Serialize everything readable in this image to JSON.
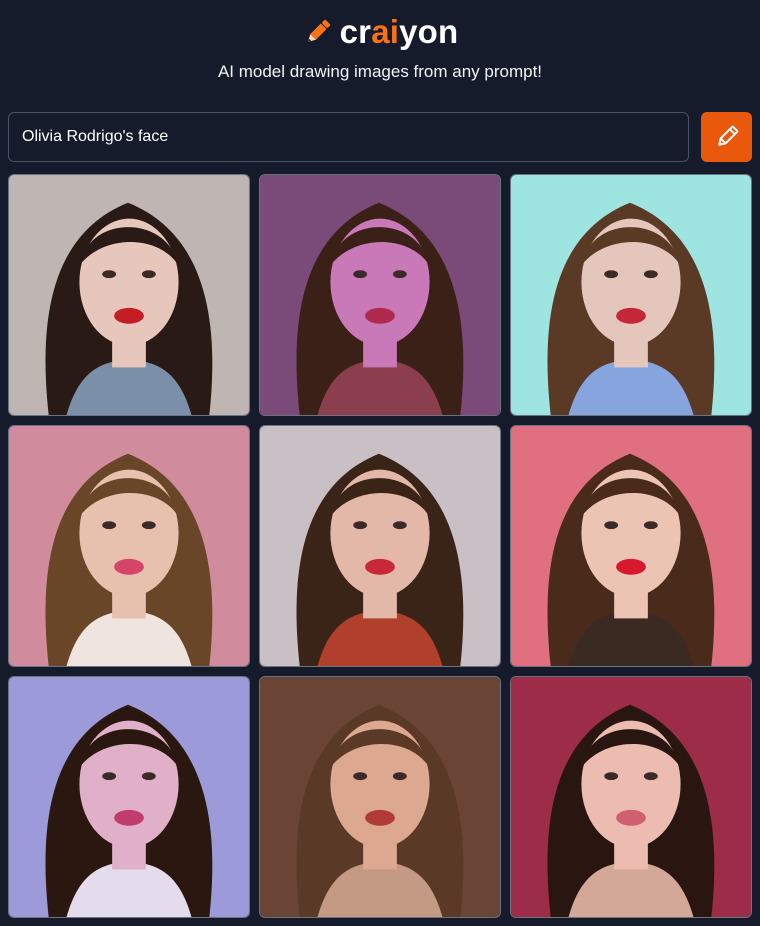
{
  "header": {
    "logo_part1": "cr",
    "logo_accent": "ai",
    "logo_part2": "yon",
    "tagline": "AI model drawing images from any prompt!"
  },
  "prompt": {
    "value": "Olivia Rodrigo's face"
  },
  "colors": {
    "background": "#151b2b",
    "accent": "#ea580c",
    "logo_accent": "#f97316"
  },
  "icons": {
    "logo": "pencil-icon",
    "draw_button": "pencil-icon"
  },
  "images": [
    {
      "bg": "#bfb6b4",
      "hair": "#2a1a16",
      "skin": "#e7c7bb",
      "lips": "#c41e24",
      "cloth": "#7c8fa8"
    },
    {
      "bg": "#7a4a78",
      "hair": "#3a2016",
      "skin": "#c978b8",
      "lips": "#b02a4e",
      "cloth": "#8a3e4e"
    },
    {
      "bg": "#9ee4e0",
      "hair": "#5a3a24",
      "skin": "#e4c6bc",
      "lips": "#c42838",
      "cloth": "#86a4de"
    },
    {
      "bg": "#d08c9c",
      "hair": "#6a4628",
      "skin": "#e8c0ae",
      "lips": "#d6446a",
      "cloth": "#efe4e0"
    },
    {
      "bg": "#c8c0c4",
      "hair": "#3a2418",
      "skin": "#e4b8a8",
      "lips": "#c8283a",
      "cloth": "#b0402c"
    },
    {
      "bg": "#e07080",
      "hair": "#4a2a1a",
      "skin": "#ecc4b4",
      "lips": "#d8182c",
      "cloth": "#3a2a22"
    },
    {
      "bg": "#9c9ad8",
      "hair": "#2a1810",
      "skin": "#e0b0c8",
      "lips": "#c03c6c",
      "cloth": "#e4dcec"
    },
    {
      "bg": "#6a4434",
      "hair": "#5a3a26",
      "skin": "#dca890",
      "lips": "#b03a36",
      "cloth": "#c49a84"
    },
    {
      "bg": "#9c2c48",
      "hair": "#2a1610",
      "skin": "#ecbcb0",
      "lips": "#d06070",
      "cloth": "#d4a898"
    }
  ]
}
